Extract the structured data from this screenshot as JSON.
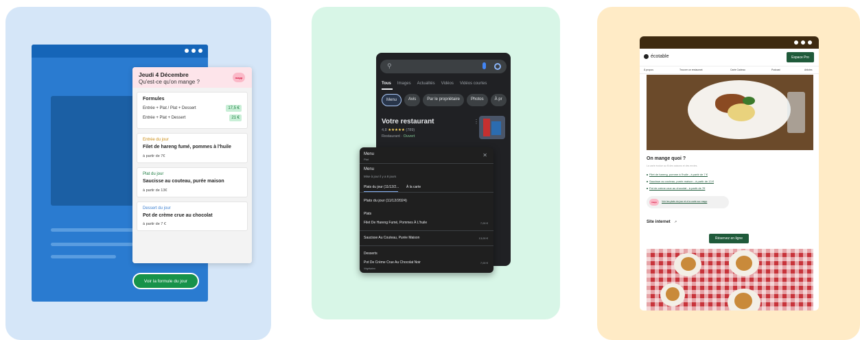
{
  "panel1": {
    "date": "Jeudi 4 Décembre",
    "question": "Qu'est-ce qu'on mange ?",
    "badge": "mapp",
    "formules": {
      "title": "Formules",
      "rows": [
        {
          "label": "Entrée + Plat / Plat + Dessert",
          "price": "17,5 €"
        },
        {
          "label": "Entrée + Plat + Dessert",
          "price": "21 €"
        }
      ]
    },
    "entree": {
      "category": "Entrée du jour",
      "dish": "Filet de hareng fumé, pommes à l'huile",
      "from": "à partir de 7€"
    },
    "plat": {
      "category": "Plat du jour",
      "dish": "Saucisse au couteau, purée maison",
      "from": "à partir de 13€"
    },
    "dessert": {
      "category": "Dessert du jour",
      "dish": "Pot de crème crue au chocolat",
      "from": "à partir de 7 €"
    },
    "cta": "Voir la formule du jour",
    "colors": {
      "entree": "#c98a10",
      "plat": "#1a7a3e",
      "dessert": "#3b7fd0"
    }
  },
  "panel2": {
    "search_icon": "search-icon",
    "tabs": [
      "Tous",
      "Images",
      "Actualités",
      "Vidéos",
      "Vidéos courtes"
    ],
    "chips": [
      "Menu",
      "Avis",
      "Par le propriétaire",
      "Photos",
      "À pr"
    ],
    "place": {
      "name": "Votre restaurant",
      "rating": "4,8",
      "stars": "★★★★★",
      "reviews": "(789)",
      "type": "Restaurant",
      "status": "Ouvert"
    },
    "menu": {
      "title": "Menu",
      "subtitle": "Plat",
      "heading": "Menu",
      "updated": "Mise à jour il y a 8 jours",
      "tabs": [
        "Plats du jour (11/12/2...",
        "À la carte"
      ],
      "date": "Plats du jour (11/12/2024)",
      "sections": [
        {
          "name": "Plats",
          "items": [
            {
              "name": "Filet De Hareng Fumé, Pommes À L'huile",
              "price": "7,00 €"
            },
            {
              "name": "Saucisse Au Couteau, Purée Maison",
              "price": "13,00 €"
            }
          ]
        },
        {
          "name": "Desserts",
          "items": [
            {
              "name": "Pot De Crème Crue Au Chocolat Noir",
              "price": "7,00 €"
            }
          ]
        }
      ],
      "veg": "Végétarien"
    }
  },
  "panel3": {
    "logo": "écotable",
    "pro_button": "Espace Pro",
    "nav": [
      "À propos",
      "Trouver un restaurant",
      "Carte Cadeau",
      "Podcast",
      "Articles"
    ],
    "question": "On mange quoi ?",
    "description": "La carte évolue au fil des saisons et des envies.",
    "items": [
      "Filet de hareng, pomme à l'huile - à partir de 7 €",
      "Saucisse au couteau, purée maison - à partir de 13 €",
      "Pot de crème crue au chocolat - à partir de 7€"
    ],
    "mapp_badge": "mapp",
    "mapp_link": "Voir les plats du jour et à la carte sur mapp",
    "site": "Site internet",
    "reserve": "Réservez en ligne"
  }
}
